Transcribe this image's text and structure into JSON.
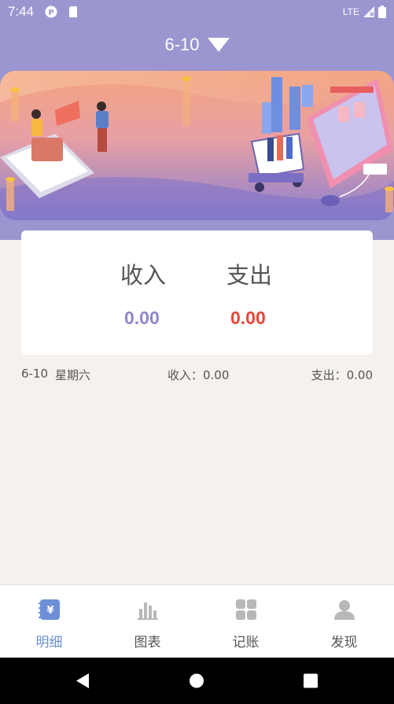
{
  "status_bar": {
    "time": "7:44",
    "network": "LTE"
  },
  "header": {
    "date_label": "6-10",
    "dropdown_icon": "triangle-down-icon"
  },
  "summary": {
    "income_label": "收入",
    "expense_label": "支出",
    "income_value": "0.00",
    "expense_value": "0.00",
    "income_color": "#8e88cc",
    "expense_color": "#e8463a"
  },
  "day_row": {
    "date": "6-10",
    "weekday": "星期六",
    "income": "收入：0.00",
    "expense": "支出：0.00"
  },
  "tabs": [
    {
      "label": "明细",
      "icon": "ledger-icon",
      "active": true
    },
    {
      "label": "图表",
      "icon": "bar-chart-icon",
      "active": false
    },
    {
      "label": "记账",
      "icon": "grid-icon",
      "active": false
    },
    {
      "label": "发现",
      "icon": "person-icon",
      "active": false
    }
  ],
  "colors": {
    "accent": "#9b95d0",
    "tab_active": "#6c8fd6"
  }
}
